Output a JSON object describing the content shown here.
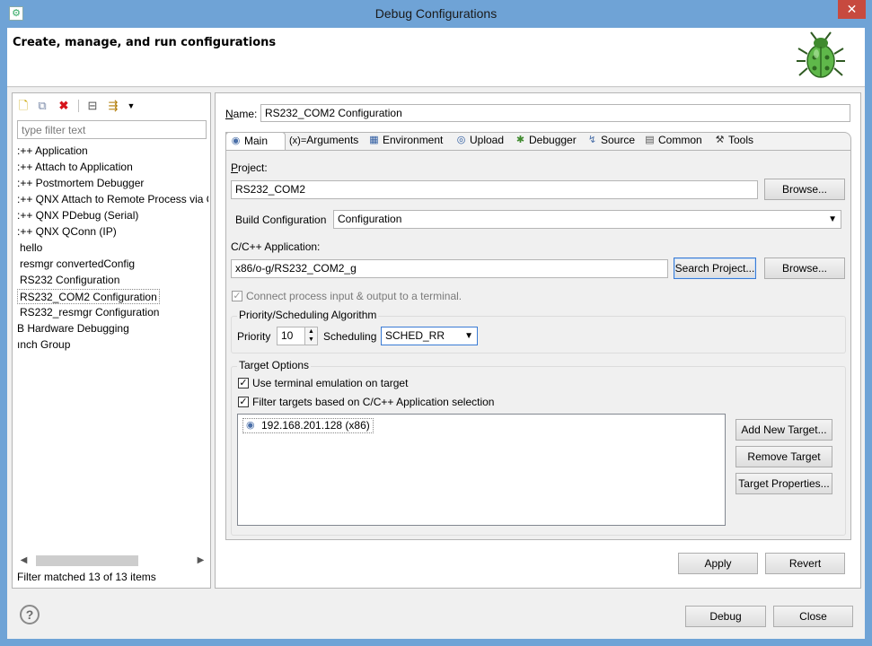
{
  "window": {
    "title": "Debug Configurations",
    "close_label": "✕",
    "header_title": "Create, manage, and run configurations"
  },
  "left": {
    "filter_placeholder": "type filter text",
    "items": [
      ":++ Application",
      ":++ Attach to Application",
      ":++ Postmortem Debugger",
      ":++ QNX Attach to Remote Process via Q",
      ":++ QNX PDebug (Serial)",
      ":++ QNX QConn (IP)",
      "hello",
      "resmgr convertedConfig",
      "RS232 Configuration",
      "RS232_COM2 Configuration",
      "RS232_resmgr Configuration",
      "B Hardware Debugging",
      "ınch Group"
    ],
    "status": "Filter matched 13 of 13 items"
  },
  "config": {
    "name_label": "Name:",
    "name_value": "RS232_COM2 Configuration",
    "tabs": [
      {
        "label": "Main",
        "icon": "main-tab-icon"
      },
      {
        "label": "Arguments",
        "icon": "arguments-tab-icon"
      },
      {
        "label": "Environment",
        "icon": "environment-tab-icon"
      },
      {
        "label": "Upload",
        "icon": "upload-tab-icon"
      },
      {
        "label": "Debugger",
        "icon": "debugger-tab-icon"
      },
      {
        "label": "Source",
        "icon": "source-tab-icon"
      },
      {
        "label": "Common",
        "icon": "common-tab-icon"
      },
      {
        "label": "Tools",
        "icon": "tools-tab-icon"
      }
    ],
    "arguments_prefix": "(x)=",
    "project_label": "Project:",
    "project_value": "RS232_COM2",
    "browse_label": "Browse...",
    "build_config_label": "Build Configuration",
    "build_config_value": "Configuration",
    "app_label": "C/C++ Application:",
    "app_value": "x86/o-g/RS232_COM2_g",
    "search_project_label": "Search Project...",
    "connect_label": "Connect process input & output to a terminal.",
    "priority_group": "Priority/Scheduling Algorithm",
    "priority_label": "Priority",
    "priority_value": "10",
    "scheduling_label": "Scheduling",
    "scheduling_value": "SCHED_RR",
    "target_group": "Target Options",
    "use_terminal_label": "Use terminal emulation on target",
    "filter_targets_label": "Filter targets based on C/C++ Application selection",
    "target_item": "192.168.201.128 (x86)",
    "add_target_label": "Add New Target...",
    "remove_target_label": "Remove Target",
    "target_props_label": "Target Properties...",
    "apply_label": "Apply",
    "revert_label": "Revert"
  },
  "footer": {
    "help_label": "?",
    "debug_label": "Debug",
    "close_label": "Close"
  },
  "colors": {
    "title_bar": "#6fa3d6",
    "close_button": "#c74a3f",
    "focus_border": "#3a7bd5"
  }
}
